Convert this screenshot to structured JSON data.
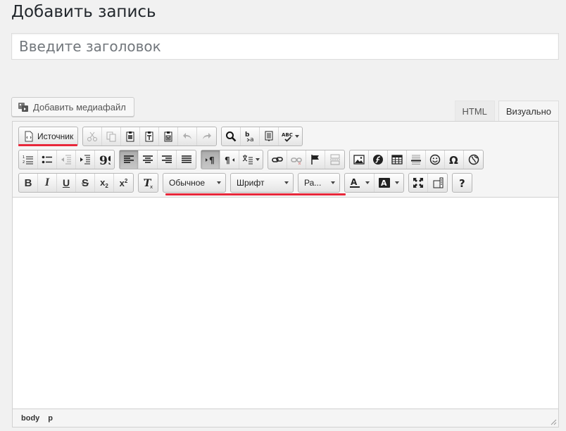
{
  "page": {
    "title": "Добавить запись"
  },
  "title_field": {
    "placeholder": "Введите заголовок",
    "value": ""
  },
  "media": {
    "button_label": "Добавить медиафайл"
  },
  "editor_tabs": [
    {
      "label": "HTML"
    },
    {
      "label": "Визуально"
    }
  ],
  "toolbar": {
    "source_label": "Источник",
    "format_combo": "Обычное",
    "font_combo": "Шрифт",
    "size_combo": "Ра..."
  },
  "statusbar": {
    "path": [
      "body",
      "p"
    ]
  },
  "accent_color": "#e8273a"
}
